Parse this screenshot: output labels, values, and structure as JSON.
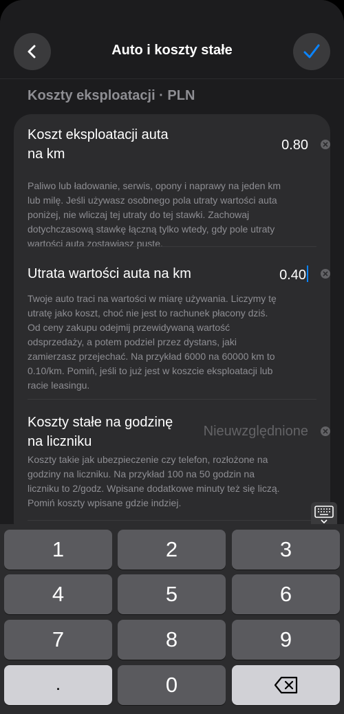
{
  "header": {
    "title": "Auto i koszty stałe",
    "back_icon": "chevron-left-icon",
    "confirm_icon": "checkmark-icon",
    "accent_color": "#0a84ff"
  },
  "section": {
    "title": "Koszty eksploatacji · PLN"
  },
  "fields": [
    {
      "label_line1": "Koszt eksploatacji auta",
      "label_line2": "na km",
      "value": "0.80",
      "description_lines": [
        "Paliwo lub ładowanie, serwis, opony i naprawy na jeden km",
        "lub milę. Jeśli używasz osobnego pola utraty wartości auta",
        "poniżej, nie wliczaj tej utraty do tej stawki. Zachowaj",
        "dotychczasową stawkę łączną tylko wtedy, gdy pole utraty",
        "wartości auta zostawiasz puste."
      ]
    },
    {
      "label_line1": "Utrata wartości auta na km",
      "value": "0.40",
      "description_lines": [
        "Twoje auto traci na wartości w miarę używania. Liczymy tę",
        "utratę jako koszt, choć nie jest to rachunek płacony dziś.",
        "Od ceny zakupu odejmij przewidywaną wartość",
        "odsprzedaży, a potem podziel przez dystans, jaki",
        "zamierzasz przejechać. Na przykład 6000 na 60000 km to",
        "0.10/km. Pomiń, jeśli to już jest w koszcie eksploatacji lub",
        "racie leasingu."
      ]
    },
    {
      "label_line1": "Koszty stałe na godzinę",
      "label_line2": "na liczniku",
      "placeholder": "Nieuwzględnione",
      "description_lines": [
        "Koszty takie jak ubezpieczenie czy telefon, rozłożone na",
        "godziny na liczniku. Na przykład 100 na 50 godzin na",
        "liczniku to 2/godz. Wpisane dodatkowe minuty też się liczą.",
        "Pomiń koszty wpisane gdzie indziej."
      ]
    }
  ],
  "keyboard": {
    "toggle_icon": "keyboard-dismiss-icon",
    "keys": [
      "1",
      "2",
      "3",
      "4",
      "5",
      "6",
      "7",
      "8",
      "9",
      ".",
      "0"
    ],
    "backspace_icon": "backspace-icon"
  }
}
